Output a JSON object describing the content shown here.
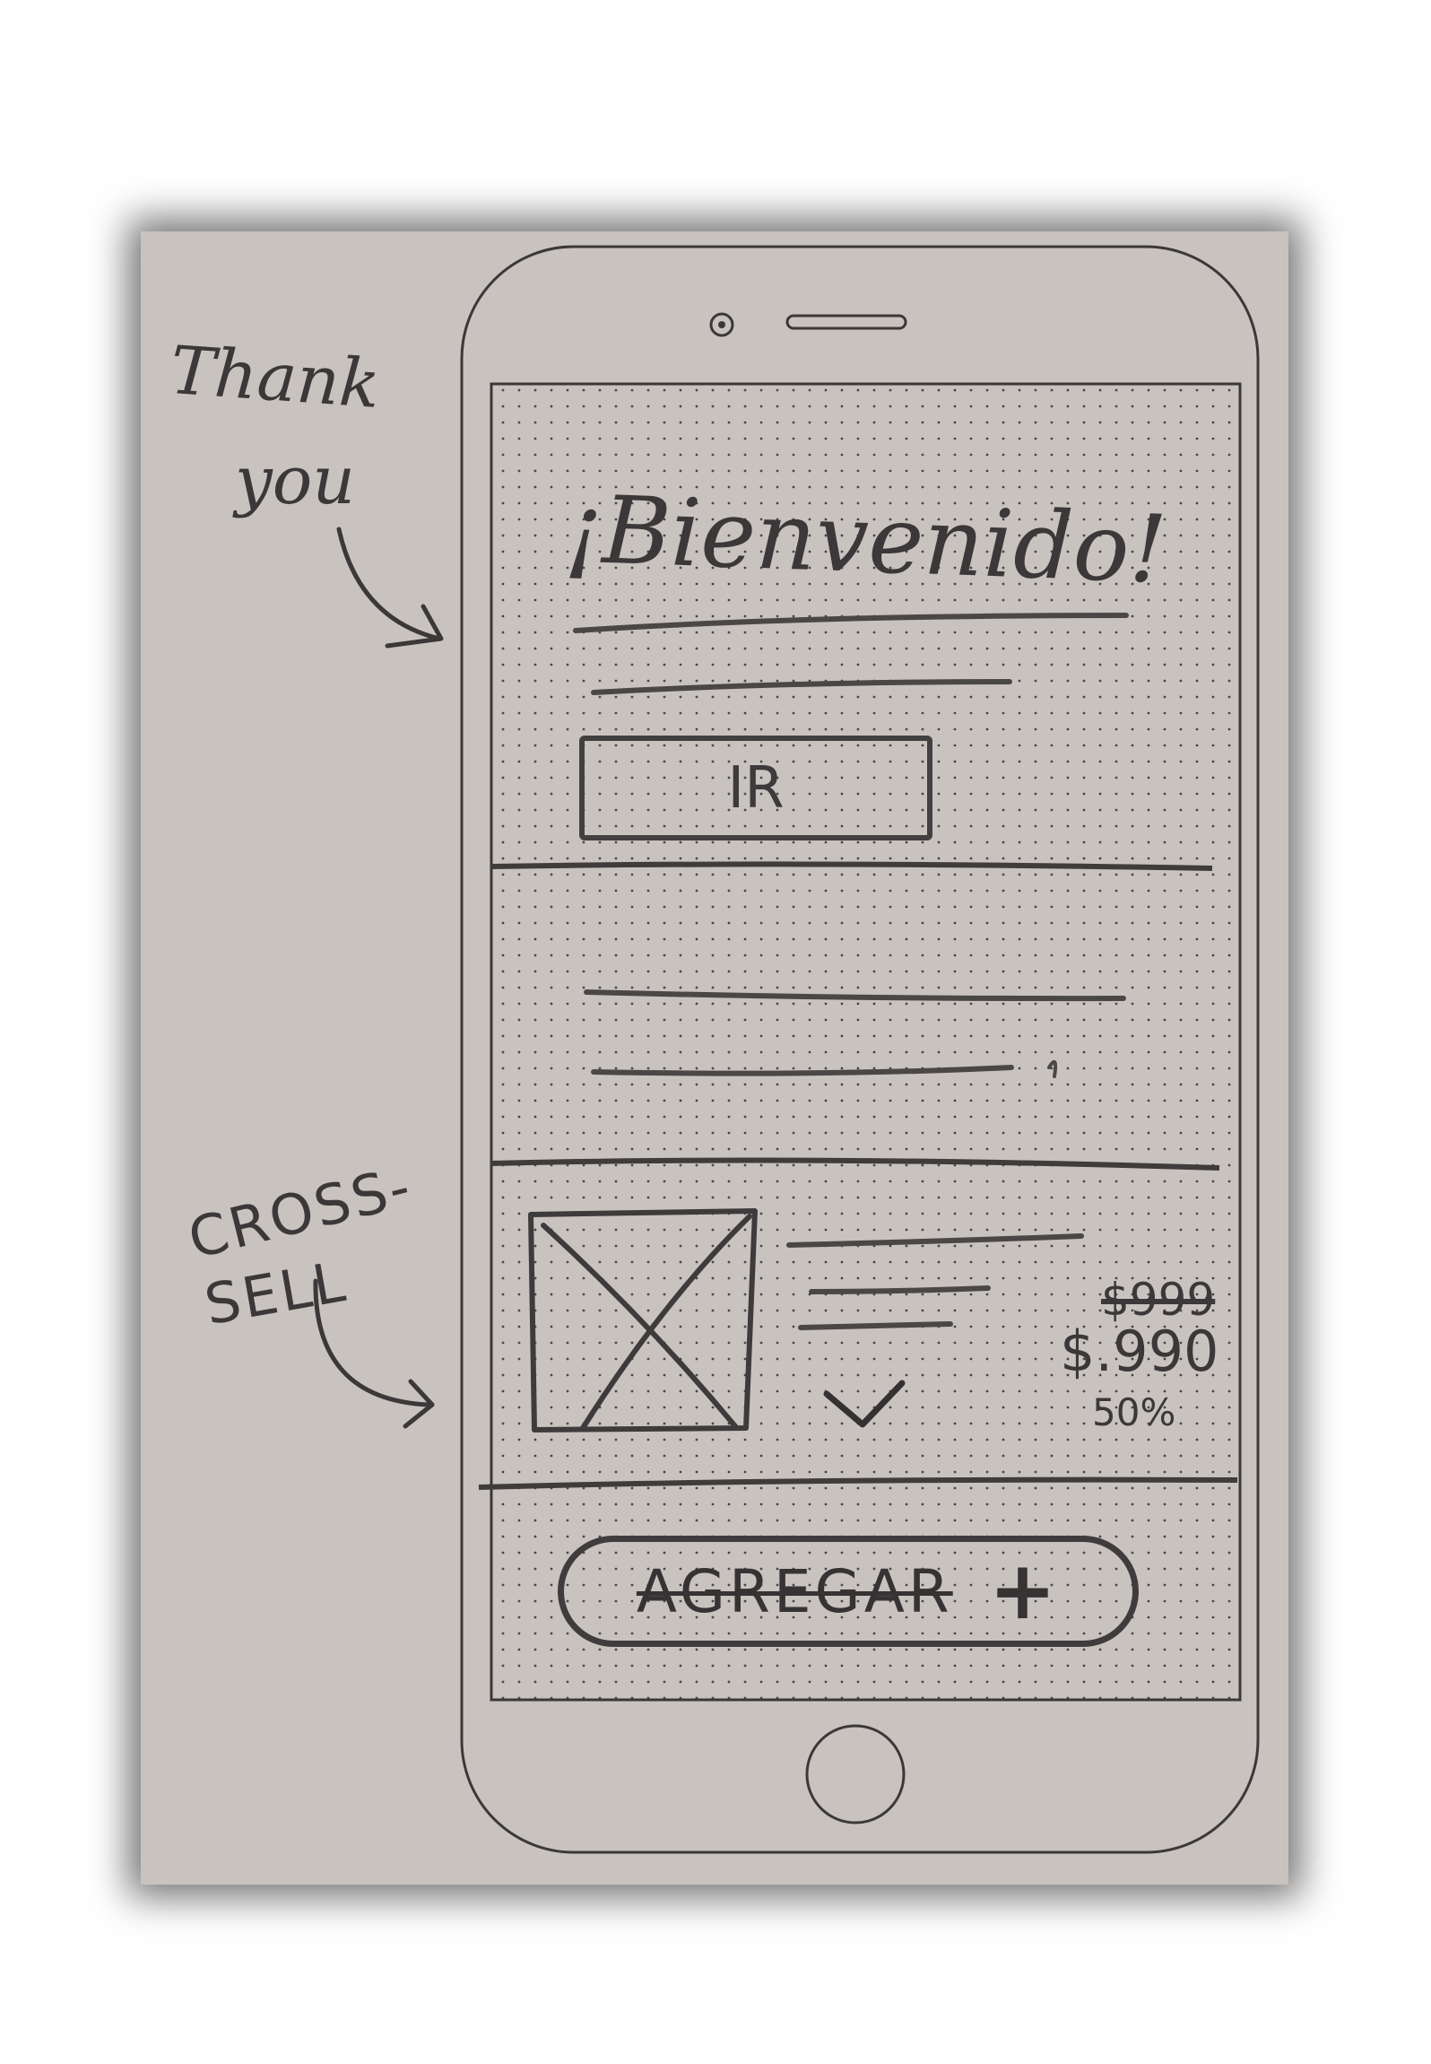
{
  "annotations": {
    "thank": "Thank",
    "you": "you",
    "cross": "CROSS-",
    "sell": "SELL"
  },
  "screen": {
    "title": "¡Bienvenido!",
    "cta_label": "IR",
    "product": {
      "old_price": "$999",
      "new_price": "$.990",
      "discount": "50%"
    },
    "add_button": {
      "label": "AGREGAR",
      "plus": "+"
    }
  },
  "colors": {
    "paper": "#c9c3c0",
    "pencil": "#3a3838",
    "shadow": "#000000"
  },
  "icons": [
    "camera-icon",
    "speaker-icon",
    "home-button-icon",
    "image-placeholder-icon",
    "checkmark-icon",
    "arrow-icon",
    "plus-icon"
  ]
}
